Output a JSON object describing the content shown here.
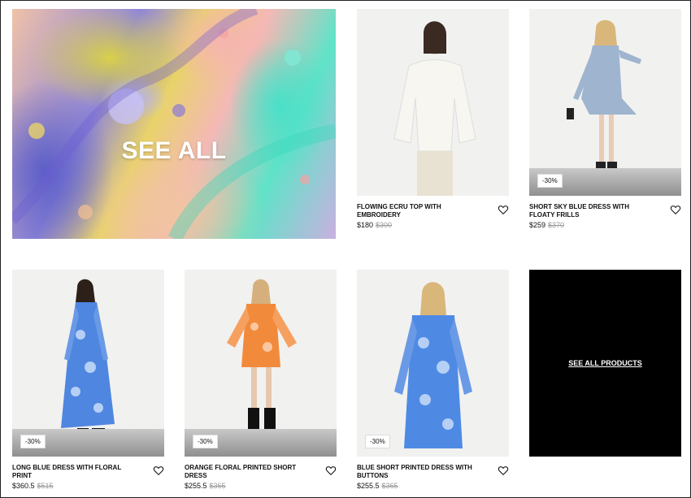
{
  "hero": {
    "label": "SEE ALL"
  },
  "see_all_products": {
    "label": "SEE ALL PRODUCTS"
  },
  "products": [
    {
      "name": "FLOWING ECRU TOP WITH EMBROIDERY",
      "price": "$180",
      "old_price": "$300",
      "badge": ""
    },
    {
      "name": "SHORT SKY BLUE DRESS WITH FLOATY FRILLS",
      "price": "$259",
      "old_price": "$370",
      "badge": "-30%"
    },
    {
      "name": "LONG BLUE DRESS WITH FLORAL PRINT",
      "price": "$360.5",
      "old_price": "$515",
      "badge": "-30%"
    },
    {
      "name": "ORANGE FLORAL PRINTED SHORT DRESS",
      "price": "$255.5",
      "old_price": "$365",
      "badge": "-30%"
    },
    {
      "name": "BLUE SHORT PRINTED DRESS WITH BUTTONS",
      "price": "$255.5",
      "old_price": "$365",
      "badge": "-30%"
    }
  ],
  "icons": {
    "favorite": "heart-outline-icon"
  },
  "colors": {
    "badge_bg": "#ffffff",
    "old_price": "#999999",
    "promo_tile": "#000000"
  }
}
